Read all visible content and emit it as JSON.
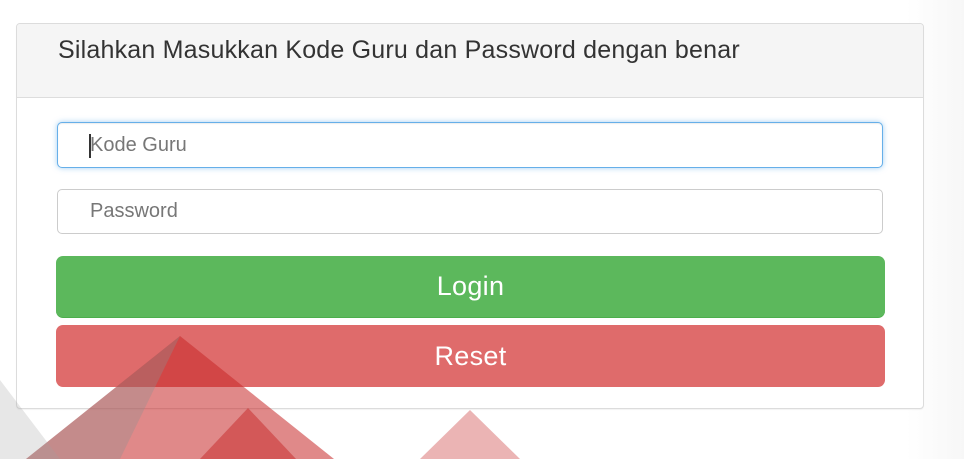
{
  "login_panel": {
    "heading": "Silahkan Masukkan Kode Guru dan Password dengan benar",
    "kode_guru": {
      "value": "",
      "placeholder": "Kode Guru"
    },
    "password": {
      "value": "",
      "placeholder": "Password"
    },
    "login_label": "Login",
    "reset_label": "Reset"
  },
  "colors": {
    "login_button": "#5cb85c",
    "reset_button": "#df6b6b",
    "focus_border": "#66afe9",
    "watermark_red": "#c62828",
    "watermark_gray": "#9e9e9e"
  },
  "icons": {
    "watermark": "watermark-logo-icon"
  }
}
